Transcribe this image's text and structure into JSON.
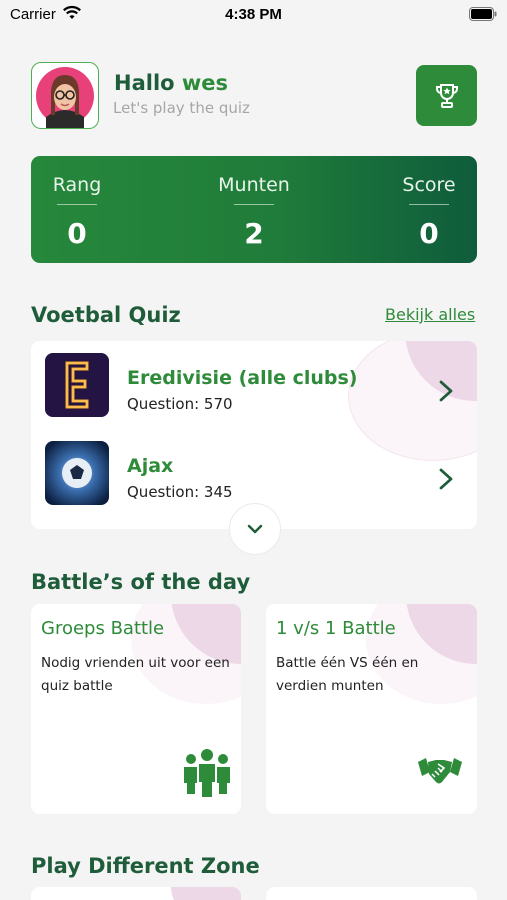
{
  "status_bar": {
    "carrier": "Carrier",
    "time": "4:38 PM"
  },
  "header": {
    "greeting": "Hallo",
    "username": "wes",
    "subtitle": "Let's play the quiz",
    "trophy_icon": "trophy-icon"
  },
  "stats": {
    "rang_label": "Rang",
    "rang_value": "0",
    "munten_label": "Munten",
    "munten_value": "2",
    "score_label": "Score",
    "score_value": "0"
  },
  "quiz_section": {
    "title": "Voetbal Quiz",
    "see_all": "Bekijk alles",
    "items": [
      {
        "title": "Eredivisie (alle clubs)",
        "count": "Question: 570"
      },
      {
        "title": "Ajax",
        "count": "Question: 345"
      }
    ]
  },
  "battles_section": {
    "title": "Battle’s of the day",
    "cards": [
      {
        "title": "Groeps Battle",
        "description": "Nodig vrienden uit voor een quiz battle",
        "icon": "group-icon"
      },
      {
        "title": "1 v/s 1 Battle",
        "description": "Battle één VS één en verdien munten",
        "icon": "handshake-icon"
      }
    ]
  },
  "zones_section": {
    "title": "Play Different Zone"
  },
  "colors": {
    "primary_green": "#2e8b3a",
    "dark_green": "#1e5c3a",
    "accent_pink": "#ecd8e6"
  }
}
